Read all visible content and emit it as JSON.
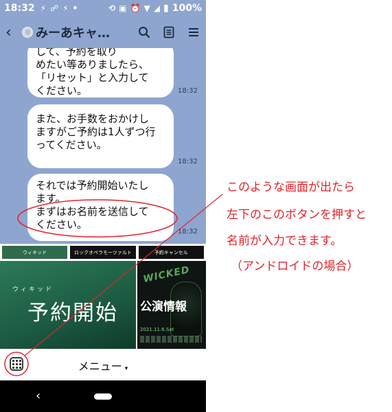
{
  "status_bar": {
    "time": "18:32",
    "icons": [
      "notification-icon",
      "missed-call-icon",
      "notification-icon",
      "dot-icon"
    ],
    "right_icons": [
      "rotate-icon",
      "cast-icon",
      "alarm-icon",
      "wifi-icon",
      "signal-icon"
    ],
    "battery": "100%"
  },
  "header": {
    "title": "みーあキャ…",
    "icons": [
      "search-icon",
      "note-icon",
      "menu-icon"
    ]
  },
  "messages": [
    {
      "lines": [
        "して、予約を取り",
        "めたい等ありましたら、",
        "「リセット」と入力して",
        "ください。"
      ],
      "time": "18:32"
    },
    {
      "lines": [
        "また、お手数をおかけし",
        "ますがご予約は1人ずつ行",
        "ってください。"
      ],
      "time": "18:32"
    },
    {
      "lines": [
        "それでは予約開始いたし",
        "ます。",
        "まずはお名前を送信して",
        "ください。"
      ],
      "time": "18:32"
    }
  ],
  "rich_menu": {
    "tabs": [
      "ウィキッド",
      "ロックオペラモーツァルト",
      "予約キャンセル"
    ],
    "main_sub": "ウィキッド",
    "main_title": "予約開始",
    "side_logo": "WICKED",
    "side_title": "公演情報",
    "side_date": "2021.11.6.Sat"
  },
  "bottom": {
    "menu_label": "メニュー",
    "caret": "▾"
  },
  "nav": {
    "back": "‹"
  },
  "annotation": {
    "lines": [
      "このような画面が出たら",
      "左下のこのボタンを押すと",
      "名前が入力できます。",
      "（アンドロイドの場合）"
    ],
    "color": "#e3242b"
  }
}
